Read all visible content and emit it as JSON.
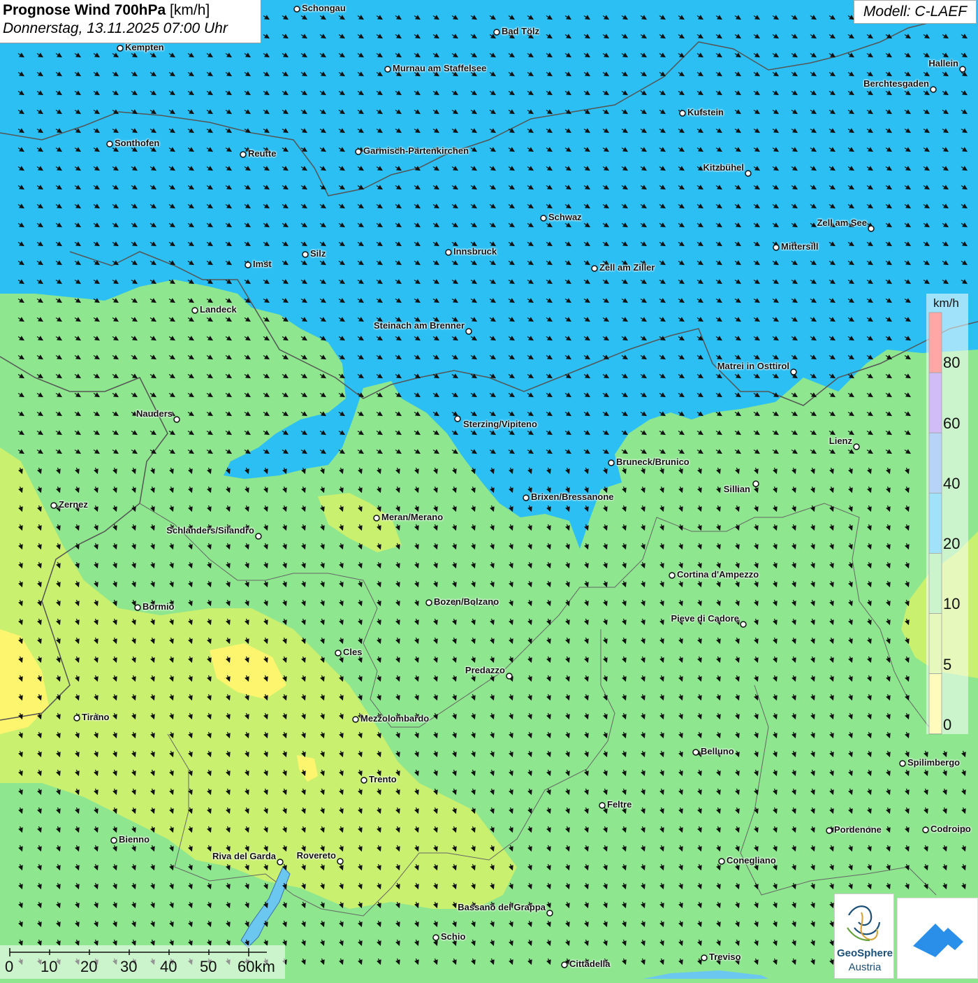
{
  "title": {
    "bold": "Prognose Wind 700hPa",
    "unit": "[km/h]",
    "datetime": "Donnerstag, 13.11.2025 07:00 Uhr"
  },
  "model": "Modell: C-LAEF",
  "legend": {
    "unit": "km/h",
    "labels": [
      "80",
      "60",
      "40",
      "20",
      "10",
      "5",
      "0"
    ],
    "colors": [
      "#ff3a3a",
      "#9b6af0",
      "#5f9df0",
      "#2bbff3",
      "#8ee68f",
      "#c9f06e",
      "#fdf56e"
    ]
  },
  "scale": {
    "labels": [
      "0",
      "10",
      "20",
      "30",
      "40",
      "50",
      "60km"
    ]
  },
  "logos": {
    "geosphere_line1": "GeoSphere",
    "geosphere_line2": "Austria"
  },
  "colors": {
    "strong_wind": "#2bbff3",
    "moderate_wind": "#8ee68f",
    "light_wind": "#c9f06e",
    "calm": "#fdf56e",
    "borders": "#555555"
  },
  "cities": [
    {
      "name": "Schongau"
    },
    {
      "name": "Bad Tölz"
    },
    {
      "name": "Kempten"
    },
    {
      "name": "Murnau am Staffelsee"
    },
    {
      "name": "Hallein"
    },
    {
      "name": "Berchtesgaden"
    },
    {
      "name": "Kufstein"
    },
    {
      "name": "Sonthofen"
    },
    {
      "name": "Reutte"
    },
    {
      "name": "Garmisch-Partenkirchen"
    },
    {
      "name": "Kitzbühel"
    },
    {
      "name": "Schwaz"
    },
    {
      "name": "Zell am See"
    },
    {
      "name": "Mittersill"
    },
    {
      "name": "Innsbruck"
    },
    {
      "name": "Silz"
    },
    {
      "name": "Imst"
    },
    {
      "name": "Zell am Ziller"
    },
    {
      "name": "Landeck"
    },
    {
      "name": "Steinach am Brenner"
    },
    {
      "name": "Matrei in Osttirol"
    },
    {
      "name": "Nauders"
    },
    {
      "name": "Sterzing/Vipiteno"
    },
    {
      "name": "Lienz"
    },
    {
      "name": "Bruneck/Brunico"
    },
    {
      "name": "Sillian"
    },
    {
      "name": "Brixen/Bressanone"
    },
    {
      "name": "Zernez"
    },
    {
      "name": "Meran/Merano"
    },
    {
      "name": "Schlanders/Silandro"
    },
    {
      "name": "Cortina d'Ampezzo"
    },
    {
      "name": "Bozen/Bolzano"
    },
    {
      "name": "Bormio"
    },
    {
      "name": "Pieve di Cadore"
    },
    {
      "name": "Cles"
    },
    {
      "name": "Predazzo"
    },
    {
      "name": "Tirano"
    },
    {
      "name": "Mezzolombardo"
    },
    {
      "name": "Belluno"
    },
    {
      "name": "Spilimbergo"
    },
    {
      "name": "Trento"
    },
    {
      "name": "Feltre"
    },
    {
      "name": "Bienno"
    },
    {
      "name": "Pordenone"
    },
    {
      "name": "Codroipo"
    },
    {
      "name": "Riva del Garda"
    },
    {
      "name": "Rovereto"
    },
    {
      "name": "Conegliano"
    },
    {
      "name": "Bassano del Grappa"
    },
    {
      "name": "Schio"
    },
    {
      "name": "Treviso"
    },
    {
      "name": "Cittadella"
    }
  ]
}
